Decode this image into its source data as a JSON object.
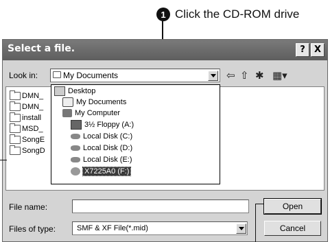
{
  "callout": {
    "number": "1",
    "text": "Click the CD-ROM drive"
  },
  "dialog": {
    "title": "Select a file.",
    "help_label": "?",
    "close_label": "X",
    "look_in_label": "Look in:",
    "look_in_value": "My Documents",
    "toolbar_icons": [
      "back-icon",
      "up-folder-icon",
      "new-folder-icon",
      "view-menu-icon"
    ],
    "file_list": [
      "DMN_",
      "DMN_",
      "install",
      "MSD_",
      "SongE",
      "SongD"
    ],
    "dropdown_items": [
      {
        "label": "Desktop",
        "icon": "desktop-icon",
        "level": 0
      },
      {
        "label": "My Documents",
        "icon": "documents-icon",
        "level": 1
      },
      {
        "label": "My Computer",
        "icon": "computer-icon",
        "level": 1
      },
      {
        "label": "3½ Floppy (A:)",
        "icon": "floppy-icon",
        "level": 2
      },
      {
        "label": "Local Disk (C:)",
        "icon": "disk-icon",
        "level": 2
      },
      {
        "label": "Local Disk (D:)",
        "icon": "disk-icon",
        "level": 2
      },
      {
        "label": "Local Disk (E:)",
        "icon": "disk-icon",
        "level": 2
      },
      {
        "label": "X7225A0 (F:)",
        "icon": "cdrom-icon",
        "level": 2,
        "selected": true
      }
    ],
    "file_name_label": "File name:",
    "file_name_value": "",
    "files_of_type_label": "Files of type:",
    "files_of_type_value": "SMF & XF File(*.mid)",
    "open_label": "Open",
    "cancel_label": "Cancel"
  }
}
